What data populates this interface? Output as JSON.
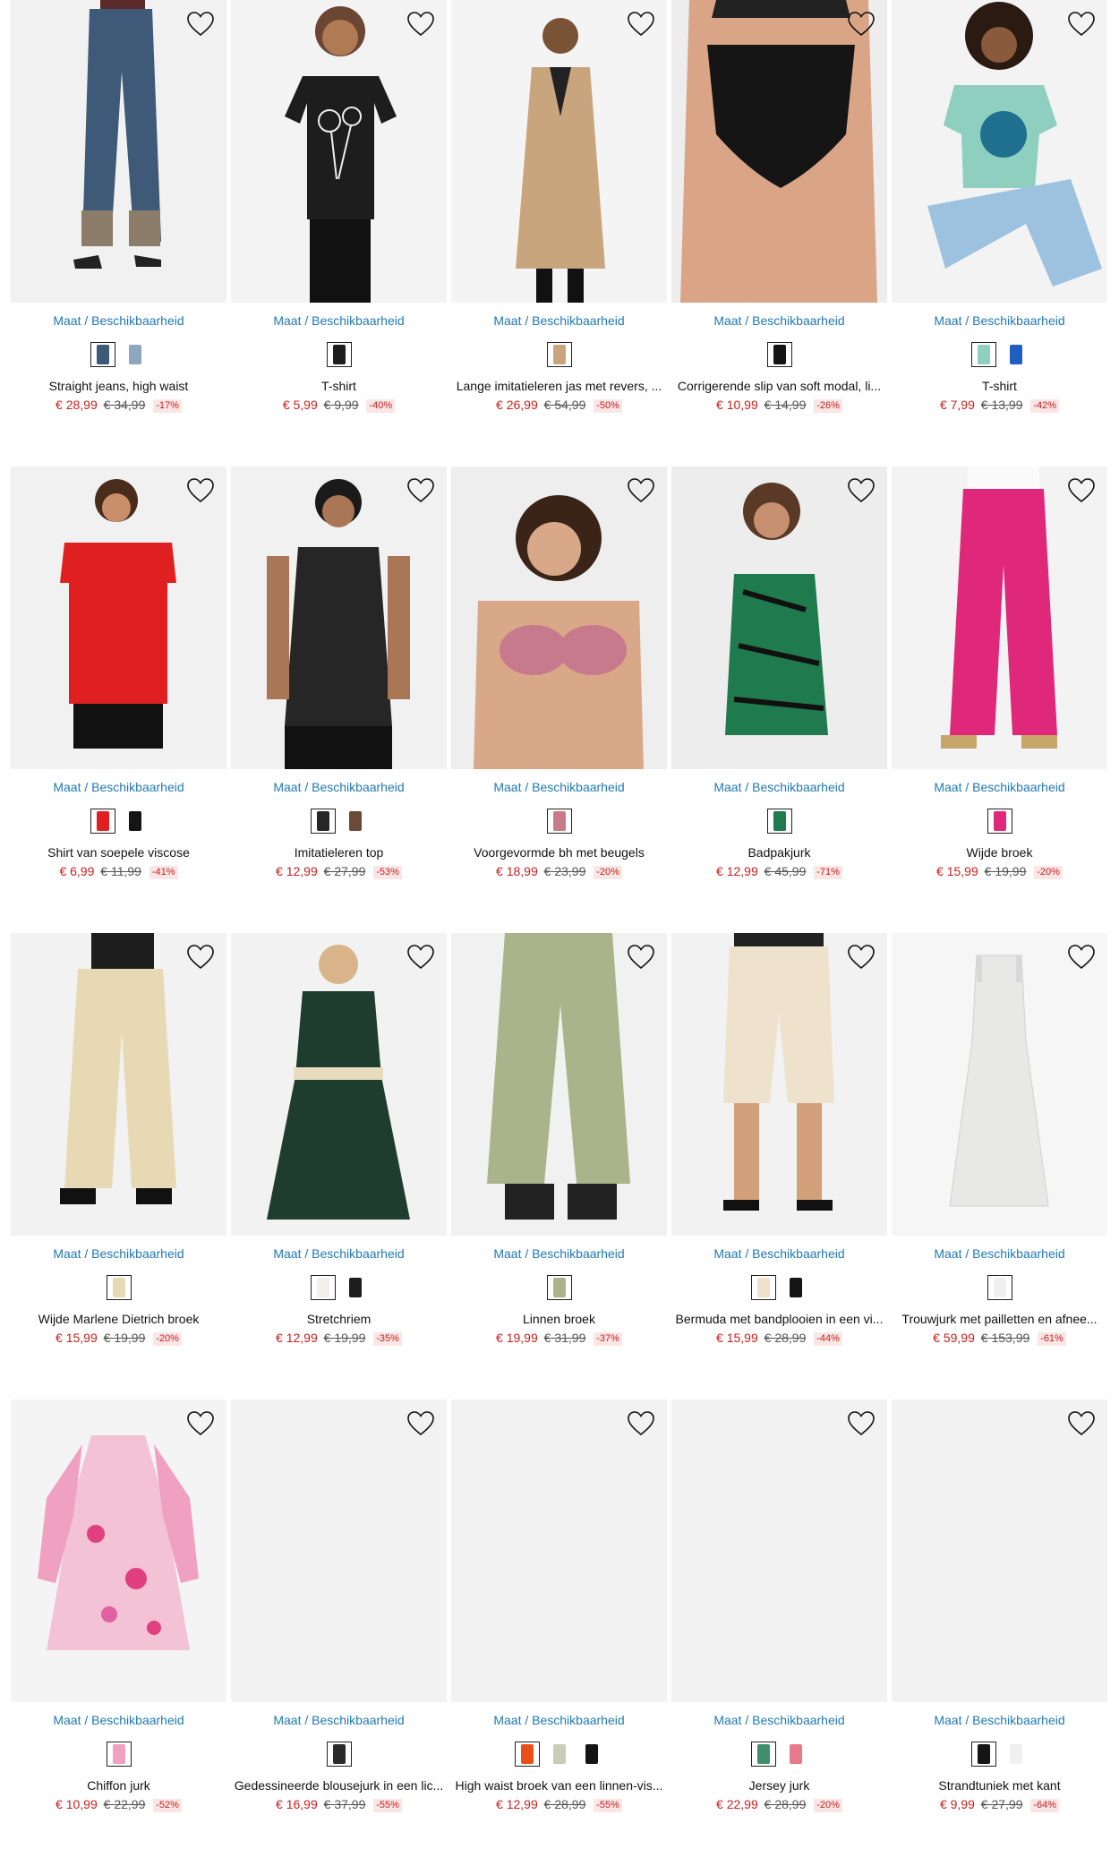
{
  "size_link_label": "Maat / Beschikbaarheid",
  "wishlist_icon": "heart-outline-icon",
  "products": [
    {
      "name": "Straight jeans, high waist",
      "price": "€ 28,99",
      "old_price": "€ 34,99",
      "discount": "-17%",
      "photo": "jeans",
      "colors": [
        "#3e5a78",
        "#8fa7bd"
      ]
    },
    {
      "name": "T-shirt",
      "price": "€ 5,99",
      "old_price": "€ 9,99",
      "discount": "-40%",
      "photo": "tee-black",
      "colors": [
        "#1d1d1d"
      ]
    },
    {
      "name": "Lange imitatieleren jas met revers, ...",
      "price": "€ 26,99",
      "old_price": "€ 54,99",
      "discount": "-50%",
      "photo": "coat",
      "colors": [
        "#c9a57e"
      ]
    },
    {
      "name": "Corrigerende slip van soft modal, li...",
      "price": "€ 10,99",
      "old_price": "€ 14,99",
      "discount": "-26%",
      "photo": "slip",
      "colors": [
        "#151515"
      ]
    },
    {
      "name": "T-shirt",
      "price": "€ 7,99",
      "old_price": "€ 13,99",
      "discount": "-42%",
      "photo": "tee-mint",
      "colors": [
        "#8fcfbf",
        "#1f5fbf"
      ]
    },
    {
      "name": "Shirt van soepele viscose",
      "price": "€ 6,99",
      "old_price": "€ 11,99",
      "discount": "-41%",
      "photo": "red-shirt",
      "colors": [
        "#e02020",
        "#151515"
      ]
    },
    {
      "name": "Imitatieleren top",
      "price": "€ 12,99",
      "old_price": "€ 27,99",
      "discount": "-53%",
      "photo": "leather-top",
      "colors": [
        "#262626",
        "#6b4a38"
      ]
    },
    {
      "name": "Voorgevormde bh met beugels",
      "price": "€ 18,99",
      "old_price": "€ 23,99",
      "discount": "-20%",
      "photo": "bra",
      "colors": [
        "#c77a8c"
      ]
    },
    {
      "name": "Badpakjurk",
      "price": "€ 12,99",
      "old_price": "€ 45,99",
      "discount": "-71%",
      "photo": "swimdress",
      "colors": [
        "#1f7a4d"
      ]
    },
    {
      "name": "Wijde broek",
      "price": "€ 15,99",
      "old_price": "€ 19,99",
      "discount": "-20%",
      "photo": "pink-pants",
      "colors": [
        "#e0287a"
      ]
    },
    {
      "name": "Wijde Marlene Dietrich broek",
      "price": "€ 15,99",
      "old_price": "€ 19,99",
      "discount": "-20%",
      "photo": "beige-pants",
      "colors": [
        "#e8d9b5"
      ]
    },
    {
      "name": "Stretchriem",
      "price": "€ 12,99",
      "old_price": "€ 19,99",
      "discount": "-35%",
      "photo": "green-dress",
      "colors": [
        "#f2f0e8",
        "#1d1d1d"
      ]
    },
    {
      "name": "Linnen broek",
      "price": "€ 19,99",
      "old_price": "€ 31,99",
      "discount": "-37%",
      "photo": "linen-pants",
      "colors": [
        "#a9b48a"
      ]
    },
    {
      "name": "Bermuda met bandplooien in een vi...",
      "price": "€ 15,99",
      "old_price": "€ 28,99",
      "discount": "-44%",
      "photo": "bermuda",
      "colors": [
        "#efe2cc",
        "#151515"
      ]
    },
    {
      "name": "Trouwjurk met pailletten en afnee...",
      "price": "€ 59,99",
      "old_price": "€ 153,99",
      "discount": "-61%",
      "photo": "wedding",
      "colors": [
        "#f0f0f0"
      ]
    },
    {
      "name": "Chiffon jurk",
      "price": "€ 10,99",
      "old_price": "€ 22,99",
      "discount": "-52%",
      "photo": "chiffon",
      "colors": [
        "#f0a0c0"
      ]
    },
    {
      "name": "Gedessineerde blousejurk in een lic...",
      "price": "€ 16,99",
      "old_price": "€ 37,99",
      "discount": "-55%",
      "photo": "empty",
      "colors": [
        "#2a2a2a"
      ]
    },
    {
      "name": "High waist broek van een linnen-vis...",
      "price": "€ 12,99",
      "old_price": "€ 28,99",
      "discount": "-55%",
      "photo": "empty",
      "colors": [
        "#e8501a",
        "#c8cdb8",
        "#151515"
      ]
    },
    {
      "name": "Jersey jurk",
      "price": "€ 22,99",
      "old_price": "€ 28,99",
      "discount": "-20%",
      "photo": "empty",
      "colors": [
        "#3f8f6f",
        "#e87a8a"
      ]
    },
    {
      "name": "Strandtuniek met kant",
      "price": "€ 9,99",
      "old_price": "€ 27,99",
      "discount": "-64%",
      "photo": "empty",
      "colors": [
        "#151515",
        "#f0f0f0"
      ]
    }
  ]
}
